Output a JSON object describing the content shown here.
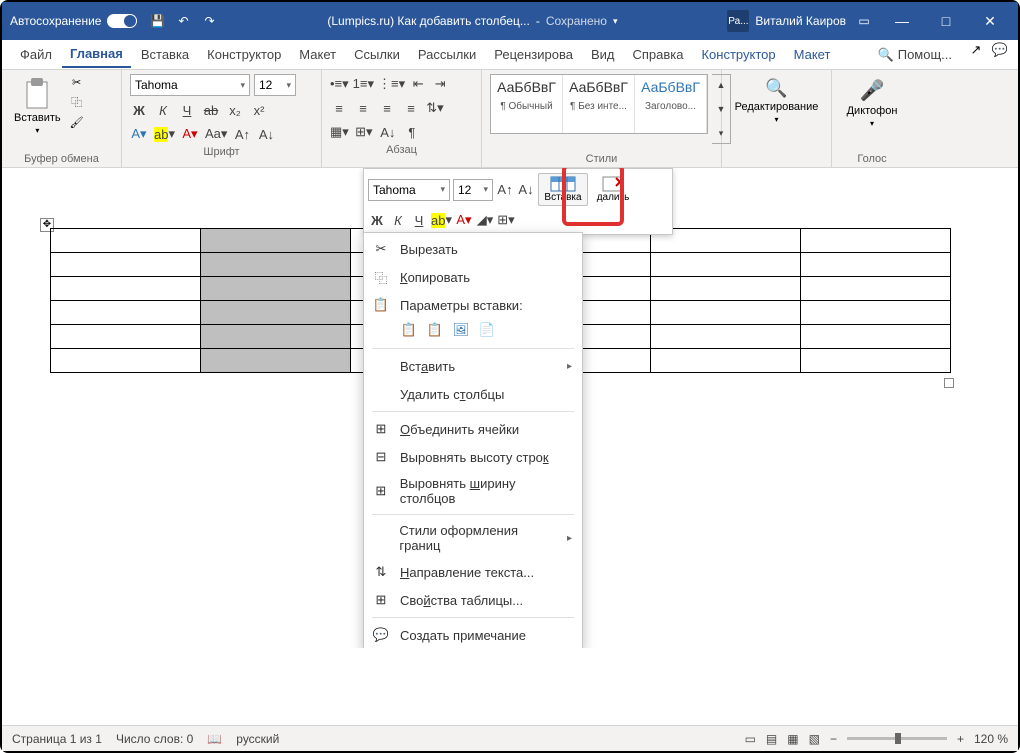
{
  "titlebar": {
    "autosave": "Автосохранение",
    "doc_title": "(Lumpics.ru) Как добавить столбец...",
    "saved_state": "Сохранено",
    "user_initials": "Ра...",
    "user_name": "Виталий Каиров"
  },
  "tabs": {
    "file": "Файл",
    "home": "Главная",
    "insert": "Вставка",
    "design": "Конструктор",
    "layout": "Макет",
    "references": "Ссылки",
    "mailings": "Рассылки",
    "review": "Рецензирова",
    "view": "Вид",
    "help": "Справка",
    "table_design": "Конструктор",
    "table_layout": "Макет",
    "tell_me": "Помощ..."
  },
  "ribbon": {
    "paste": "Вставить",
    "clipboard": "Буфер обмена",
    "font": "Шрифт",
    "paragraph": "Абзац",
    "styles": "Стили",
    "editing": "Редактирование",
    "dictate": "Диктофон",
    "voice": "Голос",
    "font_name": "Tahoma",
    "font_size": "12",
    "style1_prev": "АаБбВвГ",
    "style1_name": "¶ Обычный",
    "style2_prev": "АаБбВвГ",
    "style2_name": "¶ Без инте...",
    "style3_prev": "АаБбВвГ",
    "style3_name": "Заголово..."
  },
  "mini": {
    "font_name": "Tahoma",
    "font_size": "12",
    "insert": "Вставка",
    "delete": "далить"
  },
  "context": {
    "cut": "Вырезать",
    "copy": "Копировать",
    "paste_opts": "Параметры вставки:",
    "insert": "Вставить",
    "delete_cols": "Удалить столбцы",
    "merge": "Объединить ячейки",
    "dist_rows": "Выровнять высоту строк",
    "dist_cols": "Выровнять ширину столбцов",
    "border_styles": "Стили оформления границ",
    "text_dir": "Направление текста...",
    "table_props": "Свойства таблицы...",
    "new_comment": "Создать примечание"
  },
  "status": {
    "page": "Страница 1 из 1",
    "words": "Число слов: 0",
    "lang": "русский",
    "zoom": "120 %"
  }
}
